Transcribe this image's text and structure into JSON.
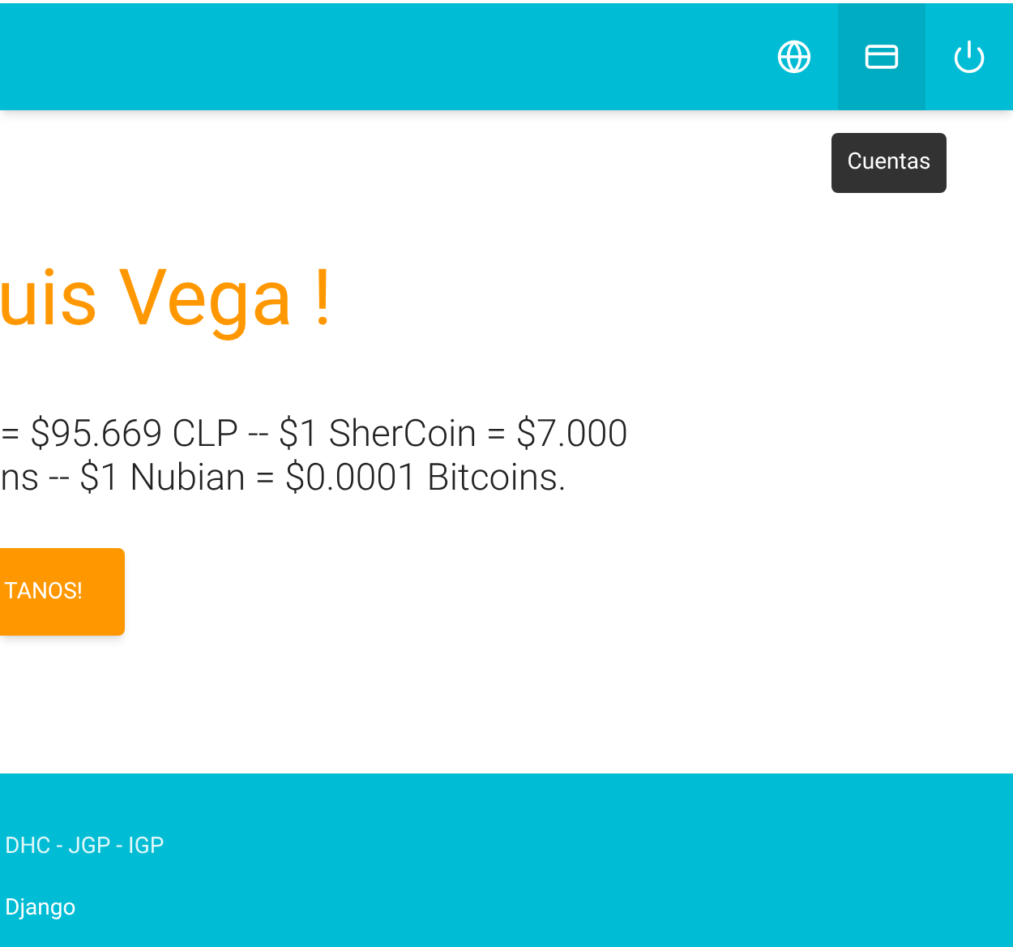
{
  "header": {
    "actions": [
      {
        "kind": "globe",
        "selected": false
      },
      {
        "kind": "card",
        "selected": true
      },
      {
        "kind": "power",
        "selected": false
      }
    ],
    "tooltip": "Cuentas"
  },
  "hero": {
    "heading": "uis Vega !",
    "lines": [
      "= $95.669 CLP -- $1 SherCoin = $7.000",
      "ns -- $1 Nubian = $0.0001 Bitcoins."
    ],
    "button": "TANOS!"
  },
  "footer": {
    "lines": [
      "DHC - JGP - IGP",
      "Django"
    ]
  }
}
